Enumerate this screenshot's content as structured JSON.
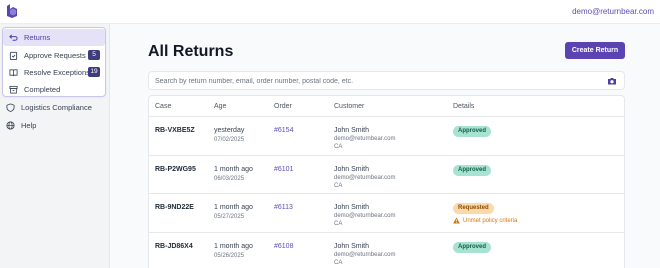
{
  "topbar": {
    "user_email": "demo@returnbear.com"
  },
  "sidebar": {
    "items": [
      {
        "label": "Returns",
        "icon": "return-arrow-icon",
        "active": true
      },
      {
        "label": "Approve Requests",
        "icon": "clipboard-check-icon",
        "badge": "5"
      },
      {
        "label": "Resolve Exceptions",
        "icon": "book-icon",
        "badge": "19"
      },
      {
        "label": "Completed",
        "icon": "archive-icon"
      },
      {
        "label": "Logistics Compliance",
        "icon": "shield-icon"
      },
      {
        "label": "Help",
        "icon": "globe-icon"
      }
    ]
  },
  "main": {
    "title": "All Returns",
    "create_button": "Create Return",
    "search_placeholder": "Search by return number, email, order number, postal code, etc."
  },
  "table": {
    "columns": [
      "Case",
      "Age",
      "Order",
      "Customer",
      "Details"
    ],
    "rows": [
      {
        "case": "RB-VXBE5Z",
        "age": "yesterday",
        "date": "07/02/2025",
        "order": "#6154",
        "name": "John Smith",
        "email": "demo@returnbear.com",
        "region": "CA",
        "status": "Approved",
        "note": ""
      },
      {
        "case": "RB-P2WG95",
        "age": "1 month ago",
        "date": "06/03/2025",
        "order": "#6101",
        "name": "John Smith",
        "email": "demo@returnbear.com",
        "region": "CA",
        "status": "Approved",
        "note": ""
      },
      {
        "case": "RB-9ND22E",
        "age": "1 month ago",
        "date": "05/27/2025",
        "order": "#6113",
        "name": "John Smith",
        "email": "demo@returnbear.com",
        "region": "CA",
        "status": "Requested",
        "note": "Unmet policy criteria"
      },
      {
        "case": "RB-JD86X4",
        "age": "1 month ago",
        "date": "05/26/2025",
        "order": "#6108",
        "name": "John Smith",
        "email": "demo@returnbear.com",
        "region": "CA",
        "status": "Approved",
        "note": ""
      }
    ]
  },
  "colors": {
    "accent": "#5b43b3",
    "approved": "#a7e3d0",
    "requested": "#fcd9a8",
    "warning": "#d97706"
  }
}
